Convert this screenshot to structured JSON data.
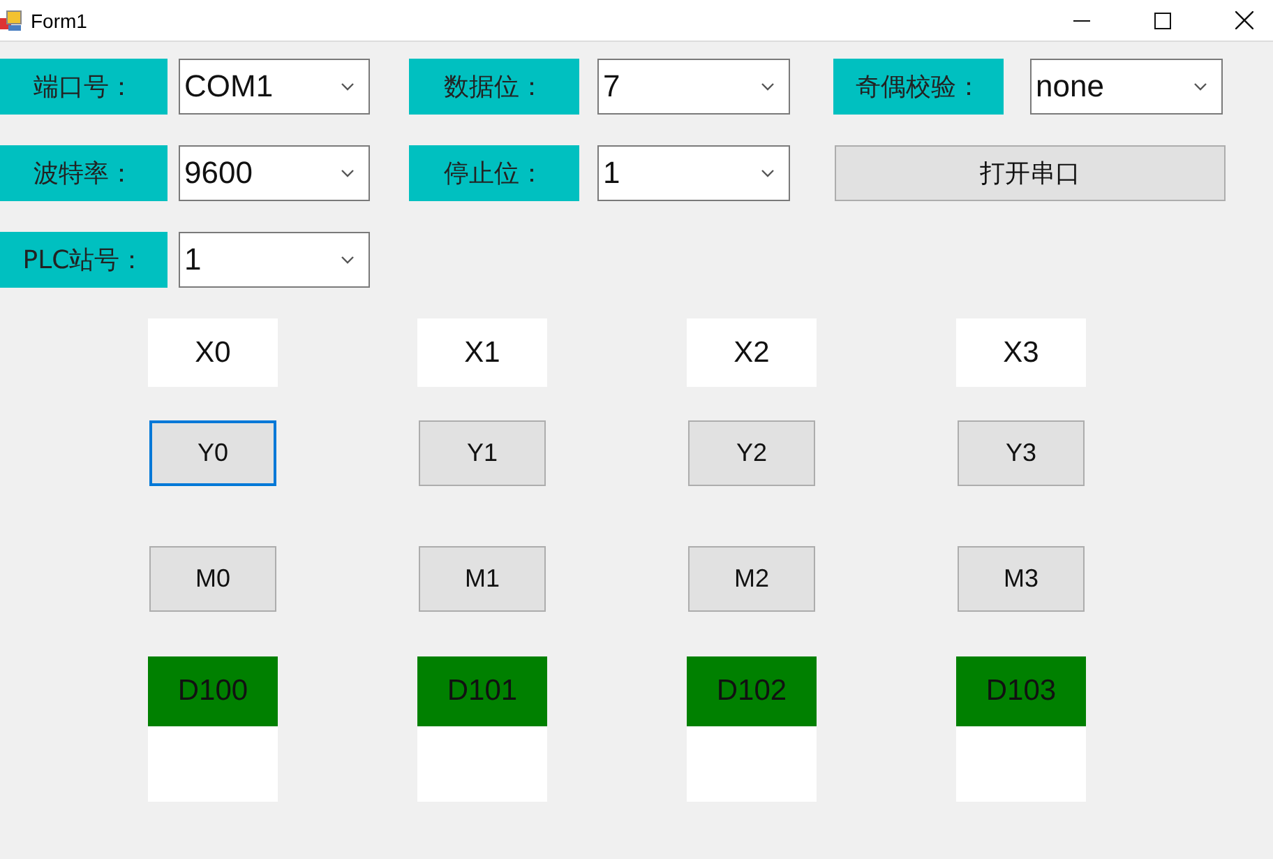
{
  "window": {
    "title": "Form1"
  },
  "settings_rows": [
    {
      "items": [
        {
          "kind": "combo",
          "label": "端口号：",
          "value": "COM1"
        },
        {
          "kind": "combo",
          "label": "数据位：",
          "value": "7"
        },
        {
          "kind": "combo",
          "label": "奇偶校验：",
          "value": "none"
        }
      ]
    },
    {
      "items": [
        {
          "kind": "combo",
          "label": "波特率：",
          "value": "9600"
        },
        {
          "kind": "combo",
          "label": "停止位：",
          "value": "1"
        },
        {
          "kind": "button",
          "label": "打开串口"
        }
      ]
    },
    {
      "items": [
        {
          "kind": "combo",
          "label": "PLC站号：",
          "value": "1"
        }
      ]
    }
  ],
  "io_columns": [
    {
      "input": "X0",
      "output": {
        "label": "Y0",
        "focused": true
      },
      "relay": "M0",
      "register": "D100"
    },
    {
      "input": "X1",
      "output": {
        "label": "Y1",
        "focused": false
      },
      "relay": "M1",
      "register": "D101"
    },
    {
      "input": "X2",
      "output": {
        "label": "Y2",
        "focused": false
      },
      "relay": "M2",
      "register": "D102"
    },
    {
      "input": "X3",
      "output": {
        "label": "Y3",
        "focused": false
      },
      "relay": "M3",
      "register": "D103"
    }
  ]
}
